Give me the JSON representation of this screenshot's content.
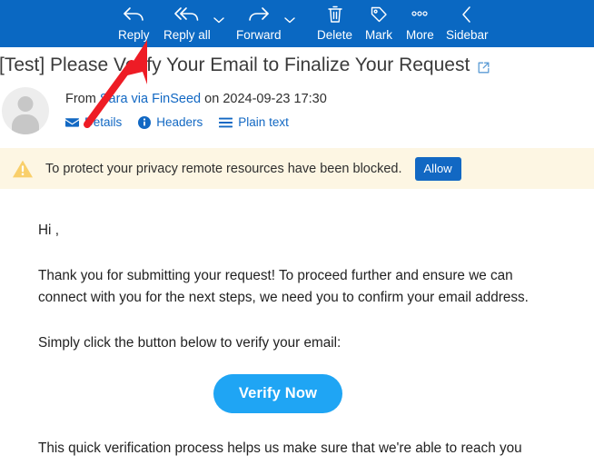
{
  "toolbar": {
    "background_color": "#0a68c2",
    "items": [
      {
        "label": "Reply",
        "icon": "reply-icon",
        "has_caret": false
      },
      {
        "label": "Reply all",
        "icon": "reply-all-icon",
        "has_caret": true
      },
      {
        "label": "Forward",
        "icon": "forward-icon",
        "has_caret": true
      },
      {
        "label": "Delete",
        "icon": "trash-icon",
        "has_caret": false
      },
      {
        "label": "Mark",
        "icon": "tag-icon",
        "has_caret": false
      },
      {
        "label": "More",
        "icon": "ellipsis-icon",
        "has_caret": false
      },
      {
        "label": "Sidebar",
        "icon": "chevron-left-icon",
        "has_caret": false
      }
    ]
  },
  "message": {
    "subject": "[Test] Please Verify Your Email to Finalize Your Request",
    "open_external_icon": "external-link-icon",
    "from_prefix": "From",
    "sender_name": "Sara via FinSeed",
    "date_prefix": "on",
    "date": "2024-09-23 17:30",
    "meta_links": [
      {
        "label": "Details",
        "icon": "envelope-icon"
      },
      {
        "label": "Headers",
        "icon": "info-circle-icon"
      },
      {
        "label": "Plain text",
        "icon": "list-lines-icon"
      }
    ]
  },
  "banner": {
    "icon": "warning-triangle-icon",
    "text": "To protect your privacy remote resources have been blocked.",
    "button_label": "Allow",
    "background_color": "#fdf6e3",
    "button_color": "#1268c3"
  },
  "body": {
    "greeting": "Hi ,",
    "paragraph_1": "Thank you for submitting your request! To proceed further and ensure we can connect with you for the next steps, we need you to confirm your email address.",
    "paragraph_2": "Simply click the button below to verify your email:",
    "cta_label": "Verify Now",
    "cta_color": "#1fa5f4",
    "paragraph_3": "This quick verification process helps us make sure that we're able to reach you"
  },
  "annotation": {
    "arrow_color": "#ee1c25",
    "points_to": "Reply"
  }
}
